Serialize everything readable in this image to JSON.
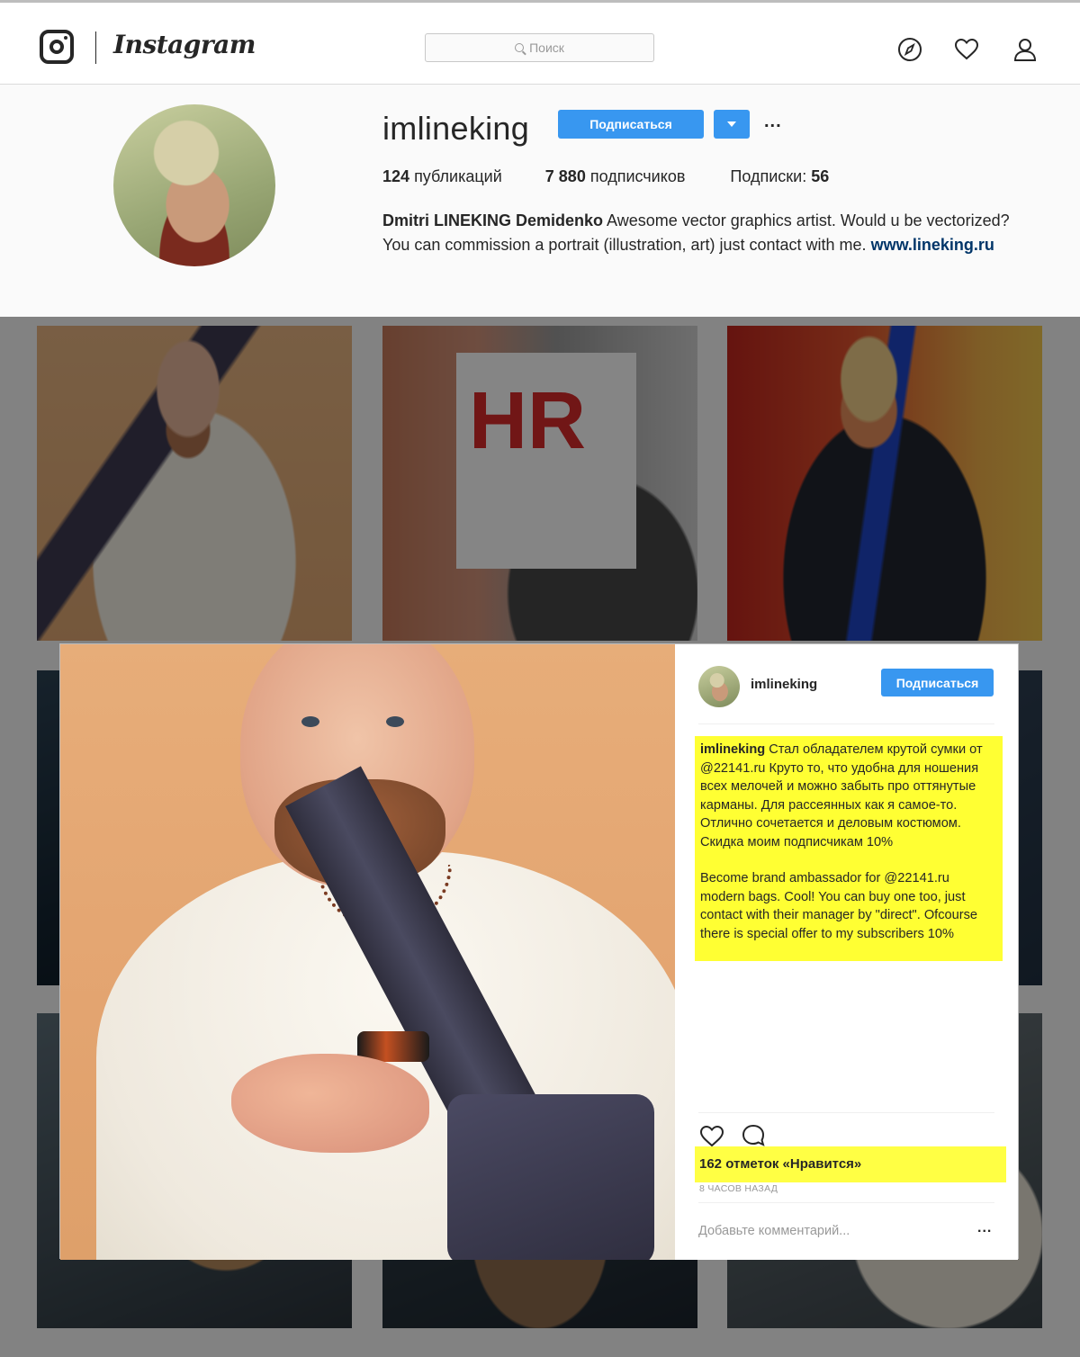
{
  "nav": {
    "logo_text": "Instagram",
    "search_placeholder": "Поиск",
    "icons": [
      "instagram-icon",
      "search-icon",
      "compass-icon",
      "heart-icon",
      "profile-icon"
    ]
  },
  "profile": {
    "username": "imlineking",
    "follow_label": "Подписаться",
    "more_label": "...",
    "posts_count": "124",
    "posts_label": "публикаций",
    "followers_count": "7 880",
    "followers_label": "подписчиков",
    "following_label": "Подписки:",
    "following_count": "56",
    "full_name": "Dmitri LINEKING Demidenko",
    "bio": "Awesome vector graphics artist. Would u be vectorized? You can commission a portrait (illustration, art) just contact with me.",
    "website": "www.lineking.ru"
  },
  "grid": {
    "thumb_text": "HR"
  },
  "post": {
    "username": "imlineking",
    "follow_label": "Подписаться",
    "caption_author": "imlineking",
    "caption_ru": "Стал обладателем крутой сумки от @22141.ru Круто то, что удобна для ношения всех мелочей и можно забыть про оттянутые карманы. Для рассеянных как я самое-то. Отлично сочетается и деловым костюмом. Скидка моим подписчикам 10%",
    "caption_en": "Become brand ambassador for @22141.ru modern bags. Cool! You can buy one too, just contact with their manager by \"direct\". Ofcourse there is special offer to my subscribers 10%",
    "likes": "162 отметок «Нравится»",
    "time_ago": "8 ЧАСОВ НАЗАД",
    "comment_placeholder": "Добавьте комментарий...",
    "more_label": "...",
    "highlight_color": "#ffff33"
  },
  "colors": {
    "accent": "#3897f0",
    "link": "#003569"
  }
}
